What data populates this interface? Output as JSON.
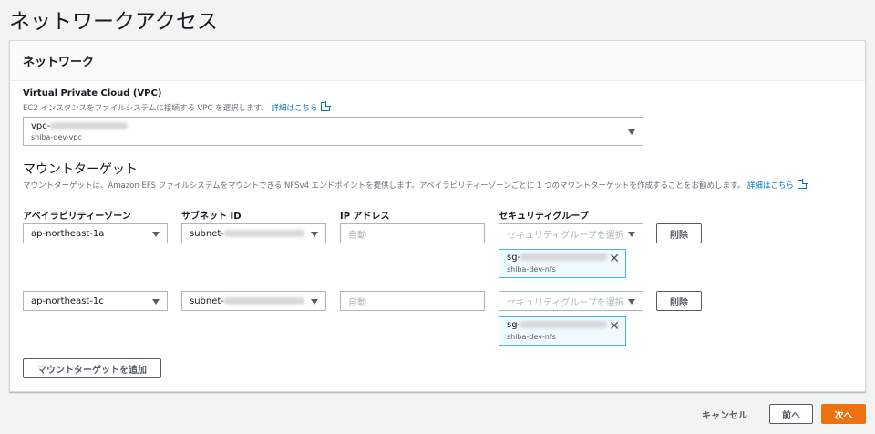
{
  "page_title": "ネットワークアクセス",
  "panel_title": "ネットワーク",
  "vpc": {
    "label": "Virtual Private Cloud (VPC)",
    "description": "EC2 インスタンスをファイルシステムに接続する VPC を選択します。",
    "link": "詳細はこちら",
    "value_prefix": "vpc-",
    "value_name": "shiba-dev-vpc"
  },
  "mount": {
    "heading": "マウントターゲット",
    "description": "マウントターゲットは、Amazon EFS ファイルシステムをマウントできる NFSv4 エンドポイントを提供します。アベイラビリティーゾーンごとに 1 つのマウントターゲットを作成することをお勧めします。",
    "link": "詳細はこちら",
    "columns": [
      "アベイラビリティーゾーン",
      "サブネット ID",
      "IP アドレス",
      "セキュリティグループ"
    ],
    "rows": [
      {
        "az": "ap-northeast-1a",
        "subnet_prefix": "subnet-",
        "ip_placeholder": "自動",
        "sg_placeholder": "セキュリティグループを選択",
        "delete": "削除",
        "sg_prefix": "sg-",
        "sg_name": "shiba-dev-nfs"
      },
      {
        "az": "ap-northeast-1c",
        "subnet_prefix": "subnet-",
        "ip_placeholder": "自動",
        "sg_placeholder": "セキュリティグループを選択",
        "delete": "削除",
        "sg_prefix": "sg-",
        "sg_name": "shiba-dev-nfs"
      }
    ],
    "add_button": "マウントターゲットを追加"
  },
  "footer": {
    "cancel": "キャンセル",
    "prev": "前へ",
    "next": "次へ"
  },
  "colors": {
    "accent": "#ec7211",
    "link": "#0073bb",
    "token_border": "#44b9d6"
  }
}
